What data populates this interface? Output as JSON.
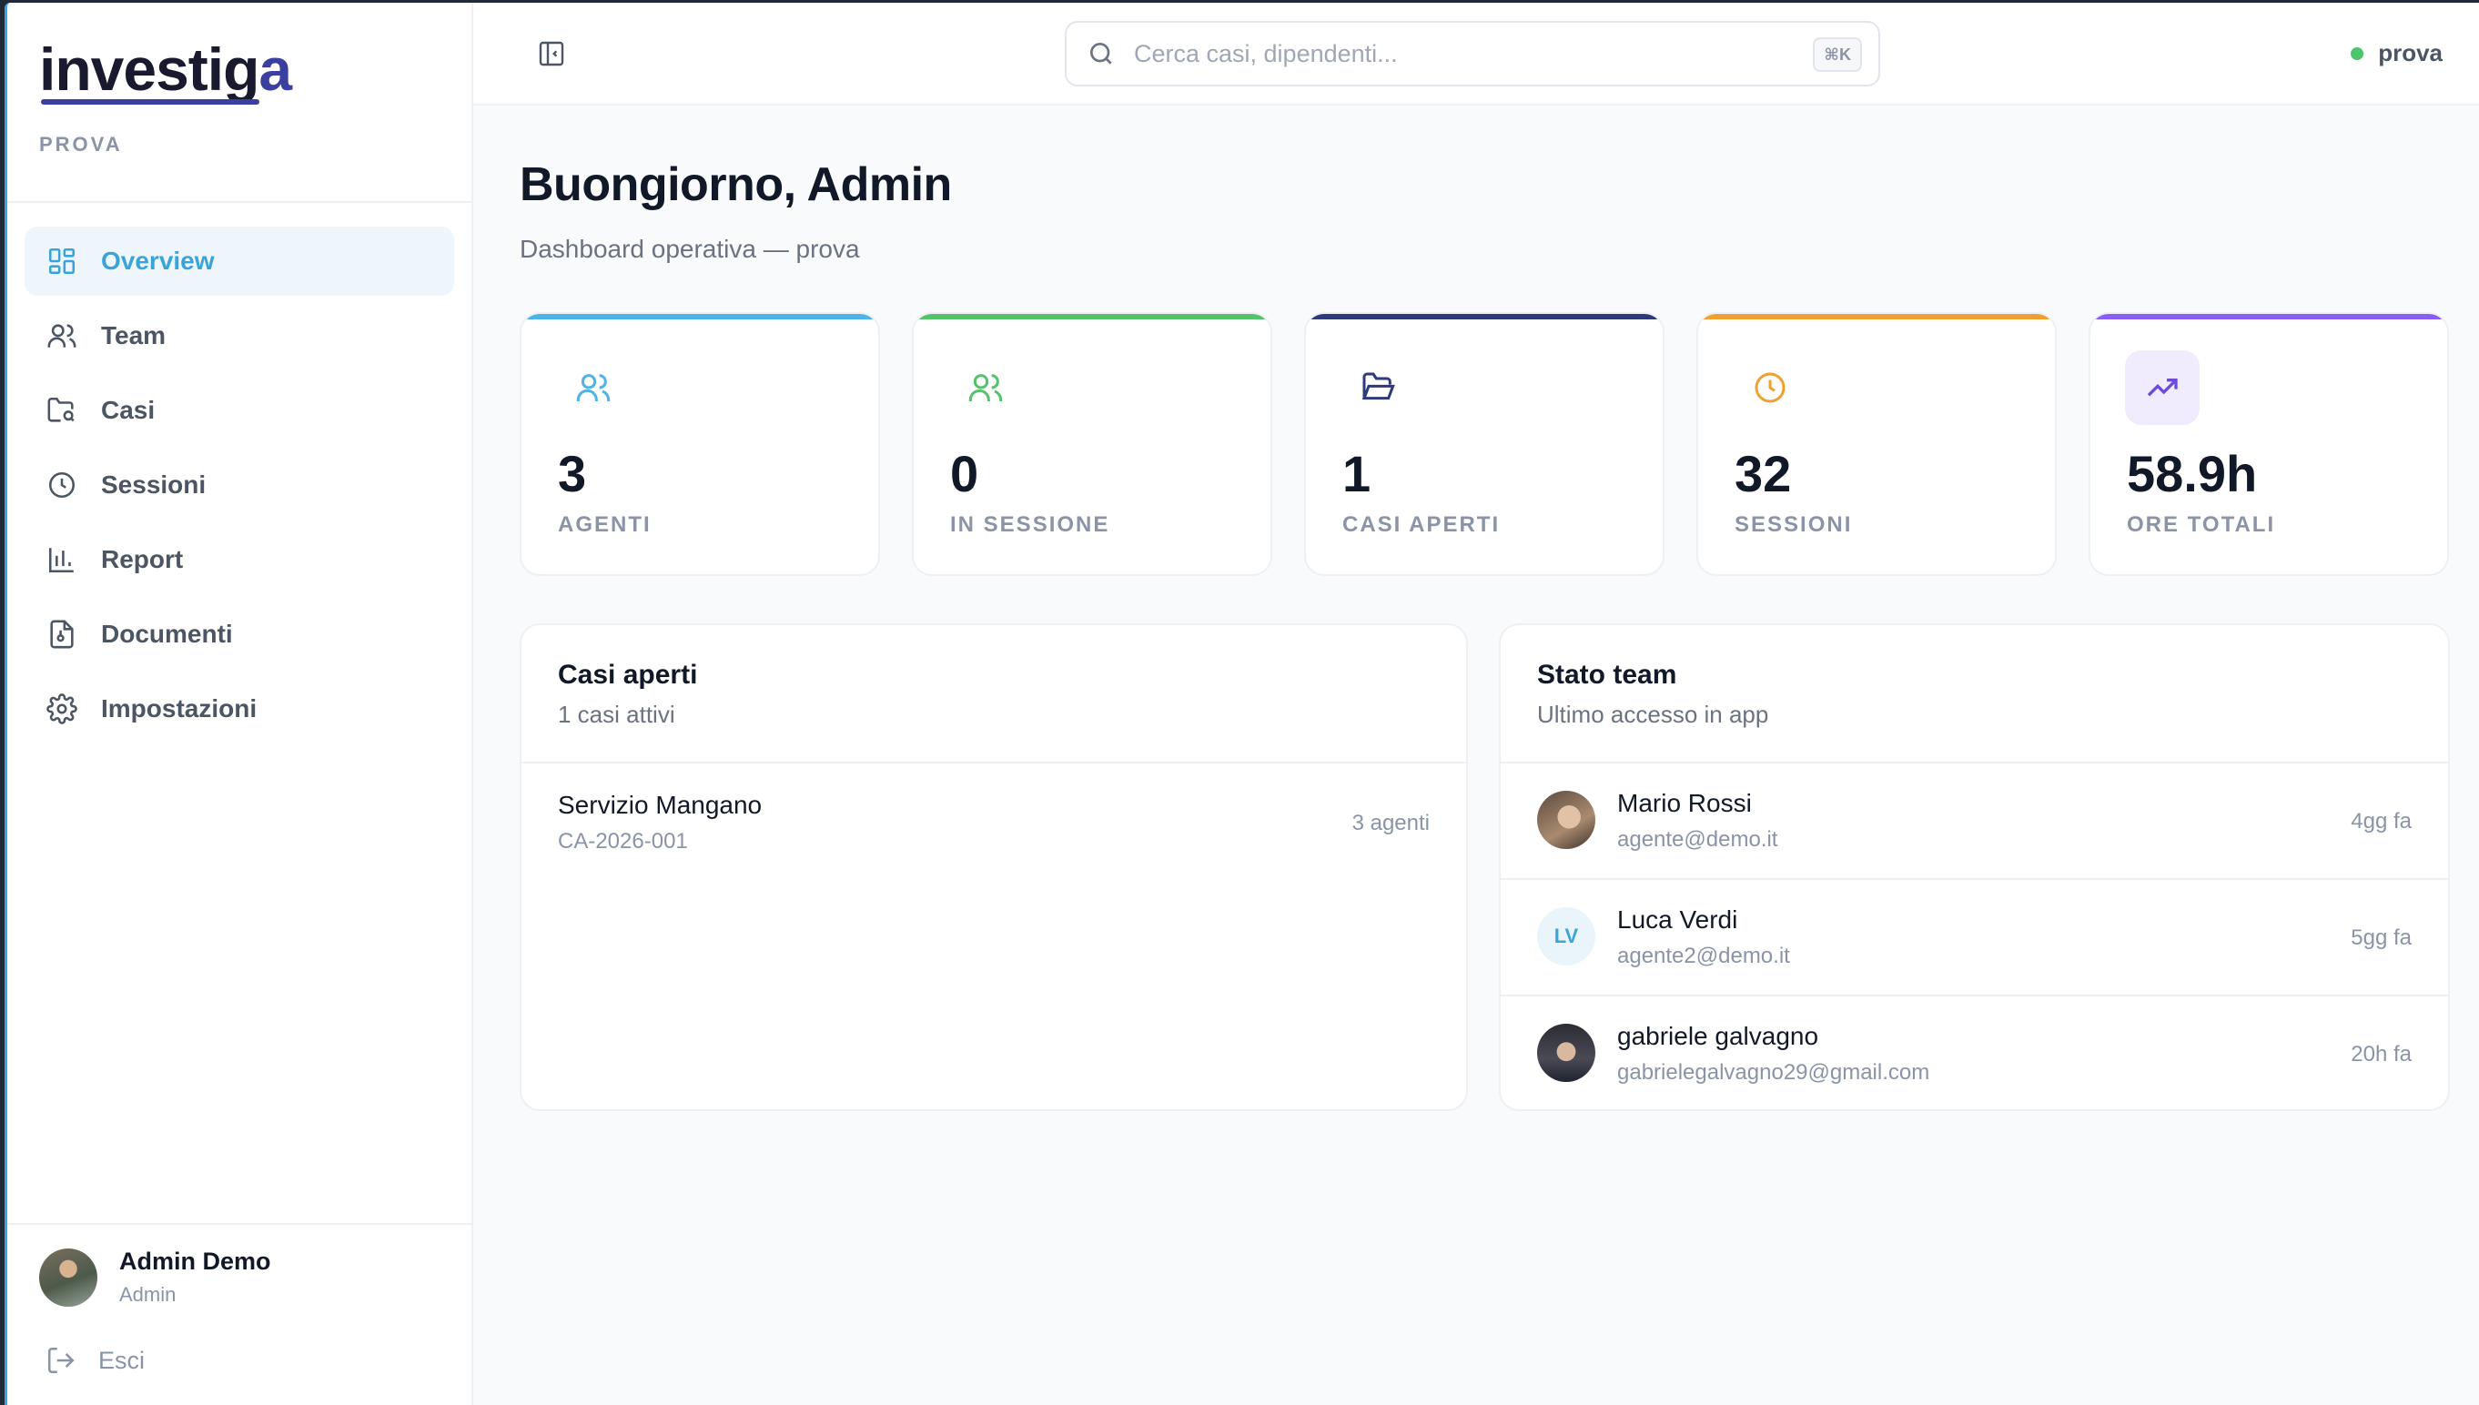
{
  "brand": {
    "logo_text": "investiga",
    "org": "PROVA"
  },
  "nav": {
    "items": [
      {
        "label": "Overview",
        "icon": "grid-icon",
        "active": true
      },
      {
        "label": "Team",
        "icon": "users-icon"
      },
      {
        "label": "Casi",
        "icon": "folder-search-icon"
      },
      {
        "label": "Sessioni",
        "icon": "clock-icon"
      },
      {
        "label": "Report",
        "icon": "bar-chart-icon"
      },
      {
        "label": "Documenti",
        "icon": "file-icon"
      },
      {
        "label": "Impostazioni",
        "icon": "gear-icon"
      }
    ]
  },
  "user": {
    "name": "Admin Demo",
    "role": "Admin",
    "logout_label": "Esci"
  },
  "header": {
    "search_placeholder": "Cerca casi, dipendenti...",
    "shortcut": "⌘K",
    "status_label": "prova",
    "status_color": "#4cc66a"
  },
  "main": {
    "title": "Buongiorno, Admin",
    "subtitle": "Dashboard operativa — prova",
    "stats": [
      {
        "value": "3",
        "label": "AGENTI",
        "color": "#4fb3e6",
        "icon": "users-icon"
      },
      {
        "value": "0",
        "label": "IN SESSIONE",
        "color": "#56c26b",
        "icon": "users-icon"
      },
      {
        "value": "1",
        "label": "CASI APERTI",
        "color": "#2e3a7a",
        "icon": "folder-open-icon"
      },
      {
        "value": "32",
        "label": "SESSIONI",
        "color": "#f0a030",
        "icon": "clock-icon"
      },
      {
        "value": "58.9h",
        "label": "ORE TOTALI",
        "color": "#8b5cf6",
        "icon": "trending-up-icon"
      }
    ],
    "cases_panel": {
      "title": "Casi aperti",
      "subtitle": "1 casi attivi",
      "rows": [
        {
          "name": "Servizio Mangano",
          "code": "CA-2026-001",
          "agents": "3 agenti"
        }
      ]
    },
    "team_panel": {
      "title": "Stato team",
      "subtitle": "Ultimo accesso in app",
      "rows": [
        {
          "name": "Mario Rossi",
          "email": "agente@demo.it",
          "time": "4gg fa"
        },
        {
          "name": "Luca Verdi",
          "email": "agente2@demo.it",
          "time": "5gg fa",
          "initials": "LV"
        },
        {
          "name": "gabriele galvagno",
          "email": "gabrielegalvagno29@gmail.com",
          "time": "20h fa"
        }
      ]
    }
  }
}
